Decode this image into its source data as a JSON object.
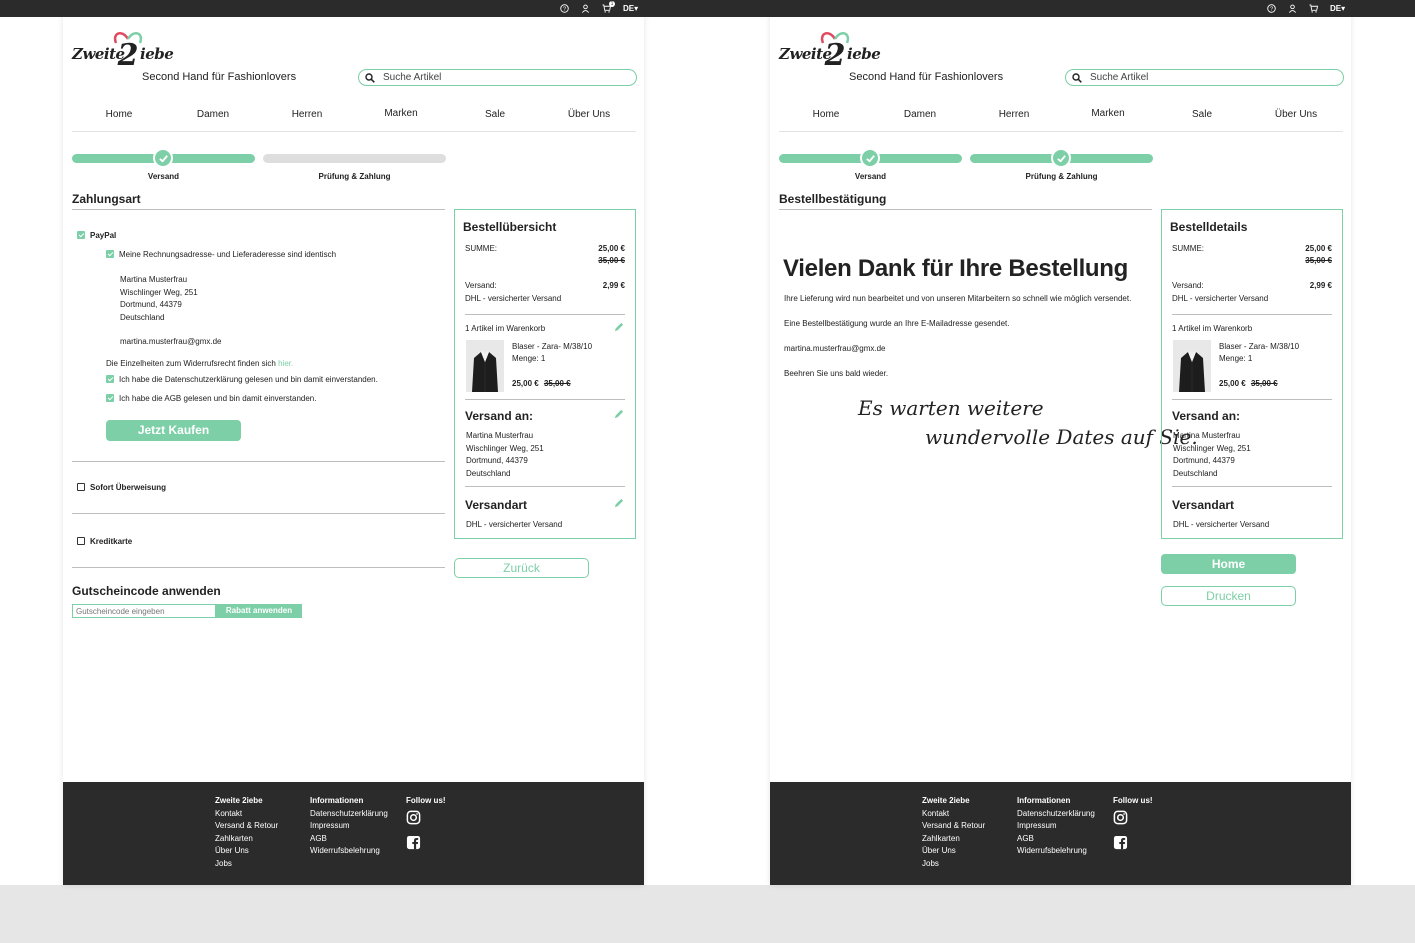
{
  "topbar": {
    "left_icons": [
      "help-icon",
      "user-icon",
      "cart-icon"
    ],
    "cart_count": "1",
    "lang": "DE"
  },
  "brand": {
    "logo_left": "Zweite",
    "logo_mid": "2",
    "logo_right": "iebe",
    "tagline": "Second Hand für Fashionlovers",
    "heart_color": "#e04a5f",
    "accent": "#7ccfa6"
  },
  "search": {
    "placeholder": "Suche Artikel"
  },
  "nav": [
    "Home",
    "Damen",
    "Herren",
    "Marken",
    "Sale",
    "Über Uns"
  ],
  "steps": [
    "Versand",
    "Prüfung & Zahlung"
  ],
  "checkout": {
    "title": "Zahlungsart",
    "paypal": "PayPal",
    "same_address": "Meine Rechnungsadresse- und Lieferaderesse sind identisch",
    "address": [
      "Martina Musterfrau",
      "Wischlinger Weg, 251",
      "Dortmund, 44379",
      "Deutschland"
    ],
    "email": "martina.musterfrau@gmx.de",
    "withdrawal_text": "Die Einzelheiten zum Widerrufsrecht finden sich",
    "withdrawal_link": "hier.",
    "privacy": "Ich habe die Datenschutzerklärung gelesen und bin damit einverstanden.",
    "agb": "Ich habe die AGB gelesen und bin damit einverstanden.",
    "buy_button": "Jetzt Kaufen",
    "sofort": "Sofort Überweisung",
    "kreditkarte": "Kreditkarte",
    "voucher_title": "Gutscheincode anwenden",
    "voucher_placeholder": "Gutscheincode eingeben",
    "voucher_button": "Rabatt anwenden",
    "back_button": "Zurück"
  },
  "summary": {
    "title_overview": "Bestellübersicht",
    "title_details": "Bestelldetails",
    "sum_label": "SUMME:",
    "sum_value": "25,00 €",
    "sum_old": "35,00 €",
    "shipping_label": "Versand:",
    "shipping_method": "DHL - versicherter Versand",
    "shipping_value": "2,99 €",
    "cart_count": "1 Artikel im Warenkorb",
    "item_name": "Blaser - Zara- M/38/10",
    "item_qty": "Menge: 1",
    "item_price": "25,00 €",
    "item_old": "35,00 €",
    "ship_to": "Versand an:",
    "ship_type": "Versandart",
    "ship_type_value": "DHL - versicherter Versand"
  },
  "confirmation": {
    "title": "Bestellbestätigung",
    "headline": "Vielen Dank für Ihre Bestellung",
    "line1": "Ihre Lieferung wird nun bearbeitet und von unseren Mitarbeitern so schnell wie möglich versendet.",
    "line2": "Eine Bestellbestätigung wurde an Ihre E-Mailadresse gesendet.",
    "email": "martina.musterfrau@gmx.de",
    "line3": "Beehren Sie uns bald wieder.",
    "script1": "Es warten weitere",
    "script2": "wundervolle Dates auf Sie.",
    "home_button": "Home",
    "print_button": "Drucken"
  },
  "footer": {
    "col1_title": "Zweite 2iebe",
    "col1": [
      "Kontakt",
      "Versand & Retour",
      "Zahlkarten",
      "Über Uns",
      "Jobs"
    ],
    "col2_title": "Informationen",
    "col2": [
      "Datenschutzerklärung",
      "Impressum",
      "AGB",
      "Widerrufsbelehrung"
    ],
    "col3_title": "Follow us!"
  }
}
